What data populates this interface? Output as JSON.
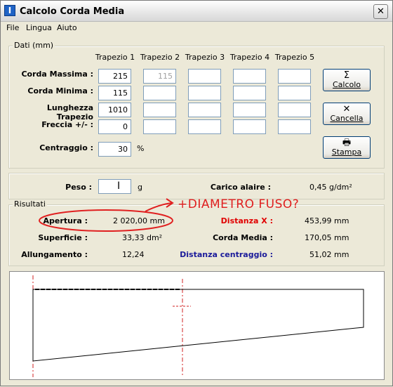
{
  "window": {
    "title": "Calcolo Corda Media"
  },
  "menu": {
    "file": "File",
    "lingua": "Lingua",
    "aiuto": "Aiuto"
  },
  "dati": {
    "group_title": "Dati (mm)",
    "columns": [
      "Trapezio 1",
      "Trapezio 2",
      "Trapezio 3",
      "Trapezio 4",
      "Trapezio 5"
    ],
    "rows": [
      {
        "label": "Corda Massima :",
        "values": [
          "215",
          "115",
          "",
          "",
          ""
        ]
      },
      {
        "label": "Corda Minima :",
        "values": [
          "115",
          "",
          "",
          "",
          ""
        ]
      },
      {
        "label": "Lunghezza Trapezio",
        "values": [
          "1010",
          "",
          "",
          "",
          ""
        ]
      },
      {
        "label": "Freccia +/- :",
        "values": [
          "0",
          "",
          "",
          "",
          ""
        ]
      }
    ],
    "centraggio": {
      "label": "Centraggio :",
      "value": "30",
      "unit": "%"
    }
  },
  "buttons": {
    "calcolo": {
      "label": "Calcolo",
      "icon": "sigma-icon"
    },
    "cancella": {
      "label": "Cancella",
      "icon": "x-icon"
    },
    "stampa": {
      "label": "Stampa",
      "icon": "printer-icon"
    }
  },
  "peso": {
    "label": "Peso :",
    "value": "",
    "unit": "g",
    "carico_label": "Carico alaire :",
    "carico_value": "0,45 g/dm²"
  },
  "risultati": {
    "group_title": "Risultati",
    "apertura_label": "Apertura :",
    "apertura_value": "2 020,00 mm",
    "superficie_label": "Superficie :",
    "superficie_value": "33,33 dm²",
    "allungamento_label": "Allungamento :",
    "allungamento_value": "12,24",
    "distanza_x_label": "Distanza X :",
    "distanza_x_value": "453,99 mm",
    "corda_media_label": "Corda Media :",
    "corda_media_value": "170,05 mm",
    "distanza_centraggio_label": "Distanza centraggio :",
    "distanza_centraggio_value": "51,02 mm"
  },
  "annotation": {
    "text": "+DIAMETRO FUSO?",
    "color": "#e02020"
  },
  "colors": {
    "accent_red": "#e00000",
    "accent_blue": "#1a1a9a"
  }
}
